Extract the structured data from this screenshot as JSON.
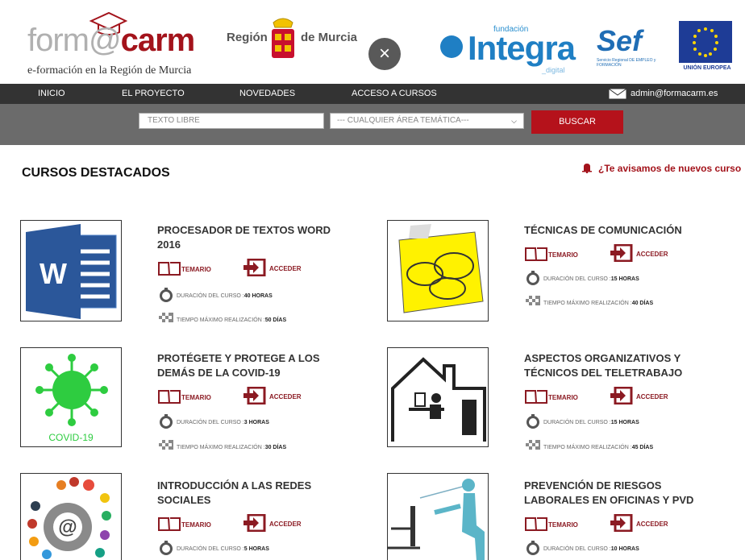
{
  "header": {
    "logo_left": "form",
    "logo_at": "@",
    "logo_right": "carm",
    "logo_subtitle": "e-formación en la Región de Murcia",
    "region_left": "Región",
    "region_right": "de Murcia",
    "close_symbol": "×",
    "integra_fundacion": "fundación",
    "integra_name": "Integra",
    "integra_digital": "_digital",
    "sef_name": "Sef",
    "sef_subtitle": "Servicio Regional DE EMPLEO y FORMACIÓN",
    "eu_label": "UNIÓN EUROPEA"
  },
  "nav": {
    "items": [
      "INICIO",
      "EL PROYECTO",
      "NOVEDADES",
      "ACCESO A CURSOS"
    ],
    "email": "admin@formacarm.es",
    "email_icon": "envelope-icon"
  },
  "search": {
    "text_placeholder": "TEXTO LIBRE",
    "area_selected": "--- CUALQUIER ÁREA TEMÁTICA---",
    "button_label": "BUSCAR"
  },
  "section": {
    "title": "CURSOS DESTACADOS",
    "notify_label": "¿Te avisamos de nuevos curso",
    "notify_icon": "bell-icon"
  },
  "labels": {
    "temario": "TEMARIO",
    "acceder": "ACCEDER",
    "duracion": "DURACIÓN DEL CURSO : ",
    "tiempo": "TIEMPO MÁXIMO REALIZACIÓN : "
  },
  "courses": [
    {
      "title_l1": "PROCESADOR DE TEXTOS WORD",
      "title_l2": "2016",
      "duration": "40 HORAS",
      "max_time": "50 DÍAS",
      "image": "word-icon"
    },
    {
      "title_l1": "TÉCNICAS DE COMUNICACIÓN",
      "title_l2": "",
      "duration": "15 HORAS",
      "max_time": "40 DÍAS",
      "image": "speech-bubbles-image"
    },
    {
      "title_l1": "PROTÉGETE Y PROTEGE A LOS",
      "title_l2": "DEMÁS DE LA COVID-19",
      "duration": "3 HORAS",
      "max_time": "30 DÍAS",
      "image": "virus-image",
      "image_caption": "COVID-19"
    },
    {
      "title_l1": "ASPECTOS ORGANIZATIVOS Y",
      "title_l2": "TÉCNICOS DEL TELETRABAJO",
      "duration": "15 HORAS",
      "max_time": "45 DÍAS",
      "image": "home-office-image"
    },
    {
      "title_l1": "INTRODUCCIÓN A LAS REDES",
      "title_l2": "SOCIALES",
      "duration": "5 HORAS",
      "image": "social-media-image"
    },
    {
      "title_l1": "PREVENCIÓN DE RIESGOS",
      "title_l2": "LABORALES EN OFICINAS Y PVD",
      "duration": "10 HORAS",
      "image": "ergonomics-image"
    }
  ],
  "colors": {
    "brand": "#a3131b",
    "nav_bg": "#333333",
    "search_bg": "#6b6b6b",
    "button": "#b5121b"
  }
}
